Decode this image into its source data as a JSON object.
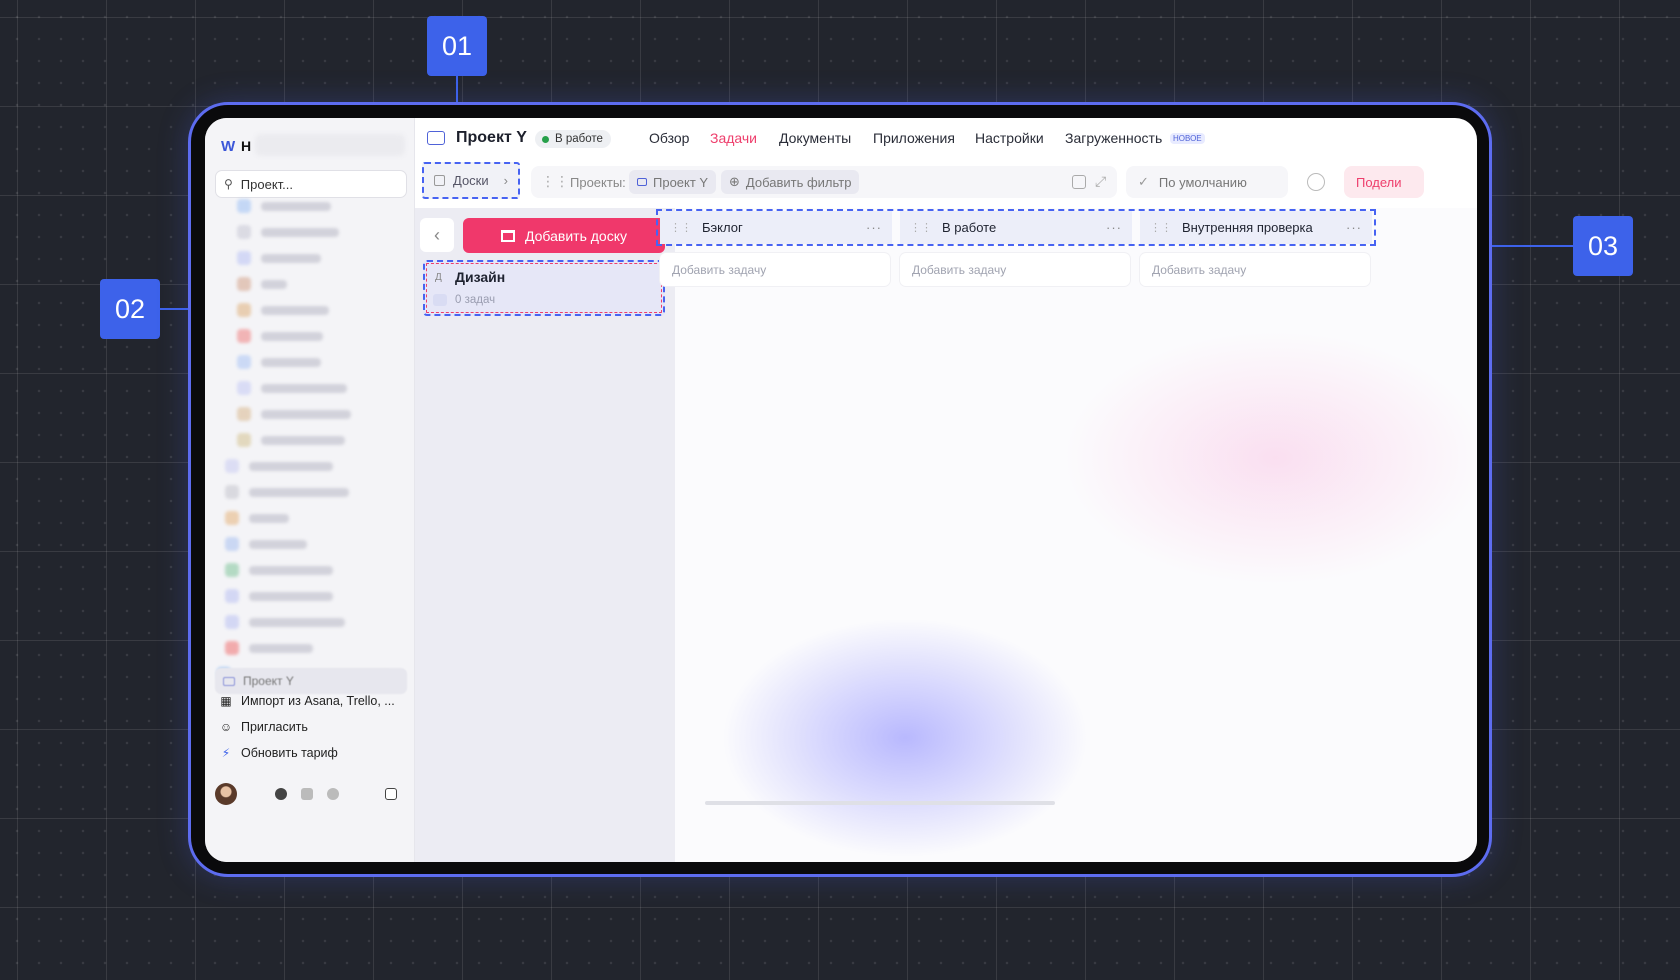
{
  "callouts": [
    "01",
    "02",
    "03"
  ],
  "sidebar": {
    "logo": "W",
    "workspace_initial": "Н",
    "search_placeholder": "Проект...",
    "active_project": "Проект Y",
    "actions": [
      {
        "icon": "trello-icon",
        "label": "Импорт из Asana, Trello, ..."
      },
      {
        "icon": "add-user-icon",
        "label": "Пригласить"
      },
      {
        "icon": "lightning-icon",
        "label": "Обновить тариф"
      }
    ]
  },
  "header": {
    "project_title": "Проект Y",
    "status": "В работе",
    "tabs": [
      "Обзор",
      "Задачи",
      "Документы",
      "Приложения",
      "Настройки",
      "Загруженность"
    ],
    "active_tab": "Задачи",
    "new_badge": "НОВОЕ"
  },
  "toolbar": {
    "boards_label": "Доски",
    "projects_label": "Проекты:",
    "project_chip": "Проект Y",
    "add_filter": "Добавить фильтр",
    "default_view": "По умолчанию",
    "share": "Подели"
  },
  "boards": {
    "add_board": "Добавить доску",
    "items": [
      {
        "letter": "Д",
        "name": "Дизайн",
        "count": "0 задач"
      }
    ]
  },
  "columns": [
    {
      "name": "Бэклог",
      "add": "Добавить задачу"
    },
    {
      "name": "В работе",
      "add": "Добавить задачу"
    },
    {
      "name": "Внутренняя проверка",
      "add": "Добавить задачу"
    }
  ],
  "colors": {
    "accent": "#3d62ea",
    "brand_pink": "#f0386b",
    "status_green": "#27a04a"
  }
}
